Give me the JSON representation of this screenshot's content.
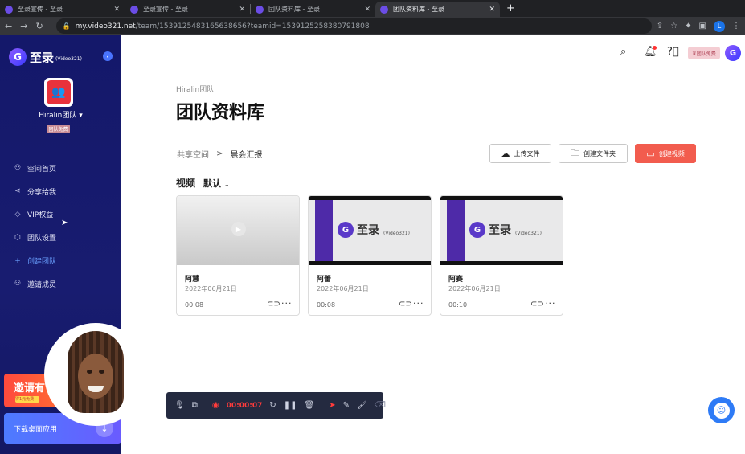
{
  "browser": {
    "tabs": [
      {
        "title": "至录宣传 - 至录",
        "active": false
      },
      {
        "title": "至录宣传 - 至录",
        "active": false
      },
      {
        "title": "团队资料库 - 至录",
        "active": false
      },
      {
        "title": "团队资料库 - 至录",
        "active": true
      }
    ],
    "new_tab": "+",
    "close_glyph": "✕",
    "url_host": "my.video321.net",
    "url_path": "/team/1539125483165638656?teamid=1539125258380791808",
    "profile_initial": "L"
  },
  "sidebar": {
    "logo_text": "至录",
    "logo_sub": "(Video321)",
    "logo_mark": "G",
    "team_name": "Hiralin团队",
    "team_badge": "团队免费",
    "menu": [
      {
        "label": "空间首页",
        "icon": "user-icon"
      },
      {
        "label": "分享给我",
        "icon": "share-icon"
      },
      {
        "label": "VIP权益",
        "icon": "diamond-icon"
      },
      {
        "label": "团队设置",
        "icon": "settings-icon"
      },
      {
        "label": "创建团队",
        "icon": "plus-icon"
      },
      {
        "label": "邀请成员",
        "icon": "add-user-icon"
      }
    ],
    "invite_banner": "邀请有",
    "invite_banner_badge": "得1元免费",
    "download_label": "下载桌面应用"
  },
  "header": {
    "crown_label": "团队免费"
  },
  "main": {
    "team_label": "Hiralin团队",
    "page_title": "团队资料库",
    "breadcrumb": [
      "共享空间",
      "晨会汇报"
    ],
    "breadcrumb_sep": ">",
    "buttons": {
      "upload": "上传文件",
      "new_folder": "创建文件夹",
      "new_video": "创建视频"
    },
    "section_title": "视频",
    "sort_label": "默认",
    "brand_word": "至录",
    "brand_sub": "(Video321)",
    "videos": [
      {
        "name": "阿慧",
        "date": "2022年06月21日",
        "duration": "00:08",
        "thumb": "blank"
      },
      {
        "name": "阿蕾",
        "date": "2022年06月21日",
        "duration": "00:08",
        "thumb": "brand"
      },
      {
        "name": "阿赛",
        "date": "2022年06月21日",
        "duration": "00:10",
        "thumb": "brand"
      }
    ]
  },
  "recorder": {
    "elapsed": "00:00:07"
  },
  "colors": {
    "sidebar_bg": "#181c70",
    "accent_red": "#f25c4e",
    "accent_blue": "#2e7bf6",
    "brand_purple": "#4e2aa8"
  }
}
